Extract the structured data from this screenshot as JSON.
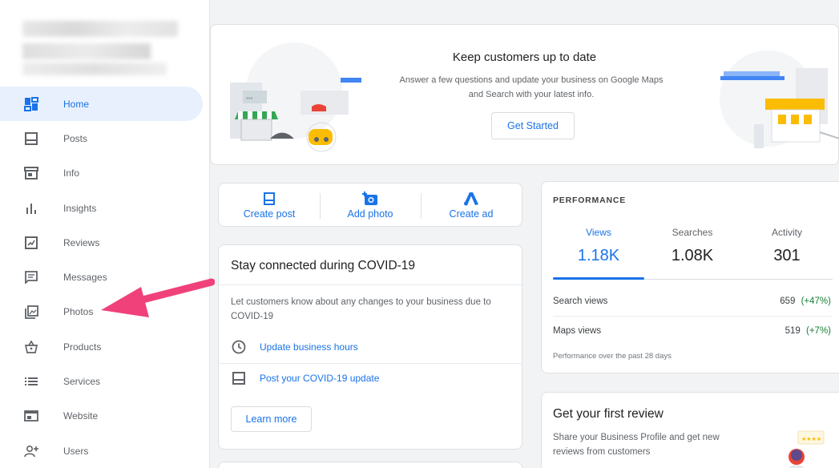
{
  "sidebar": {
    "items": [
      {
        "label": "Home",
        "icon": "home-icon"
      },
      {
        "label": "Posts",
        "icon": "posts-icon"
      },
      {
        "label": "Info",
        "icon": "info-icon"
      },
      {
        "label": "Insights",
        "icon": "insights-icon"
      },
      {
        "label": "Reviews",
        "icon": "reviews-icon"
      },
      {
        "label": "Messages",
        "icon": "messages-icon"
      },
      {
        "label": "Photos",
        "icon": "photos-icon"
      },
      {
        "label": "Products",
        "icon": "products-icon"
      },
      {
        "label": "Services",
        "icon": "services-icon"
      },
      {
        "label": "Website",
        "icon": "website-icon"
      },
      {
        "label": "Users",
        "icon": "users-icon"
      }
    ],
    "active": "Home"
  },
  "banner": {
    "title": "Keep customers up to date",
    "subtitle": "Answer a few questions and update your business on Google Maps and Search with your latest info.",
    "button": "Get Started"
  },
  "actions": [
    {
      "label": "Create post",
      "icon": "create-post-icon"
    },
    {
      "label": "Add photo",
      "icon": "add-photo-icon"
    },
    {
      "label": "Create ad",
      "icon": "google-ads-icon"
    }
  ],
  "covid": {
    "title": "Stay connected during COVID-19",
    "description": "Let customers know about any changes to your business due to COVID-19",
    "link_hours": "Update business hours",
    "link_post": "Post your COVID-19 update",
    "button": "Learn more"
  },
  "performance": {
    "heading": "PERFORMANCE",
    "tabs": [
      {
        "label": "Views",
        "value": "1.18K"
      },
      {
        "label": "Searches",
        "value": "1.08K"
      },
      {
        "label": "Activity",
        "value": "301"
      }
    ],
    "rows": [
      {
        "label": "Search views",
        "value": "659",
        "change": "(+47%)"
      },
      {
        "label": "Maps views",
        "value": "519",
        "change": "(+7%)"
      }
    ],
    "footnote": "Performance over the past 28 days"
  },
  "review": {
    "title": "Get your first review",
    "description": "Share your Business Profile and get new reviews from customers"
  },
  "colors": {
    "accent": "#1a73e8",
    "active_bg": "#e8f0fe",
    "positive": "#188038",
    "annotation_arrow": "#f0417a"
  }
}
